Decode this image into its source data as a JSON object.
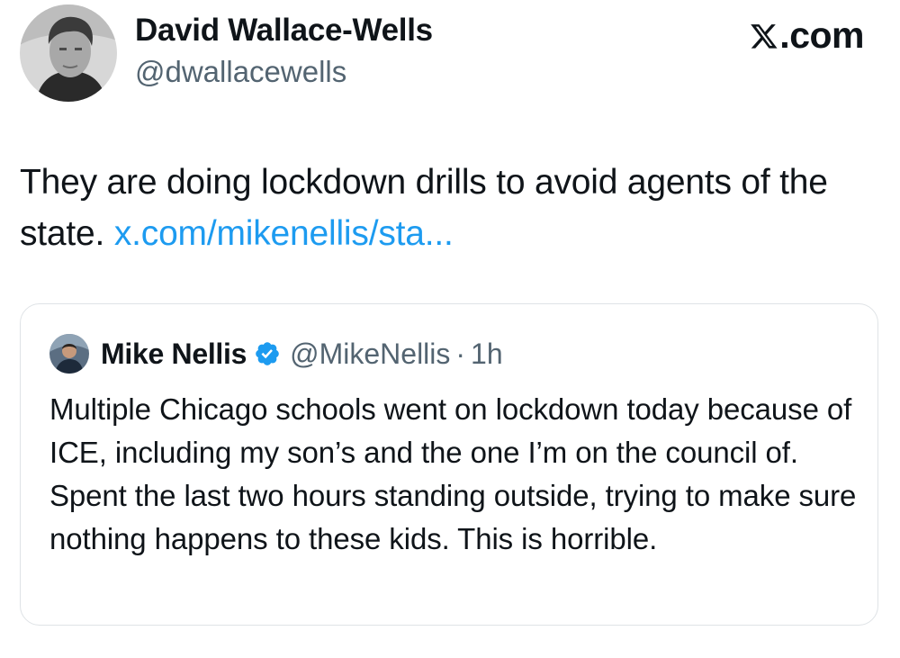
{
  "tweet": {
    "author_name": "David Wallace-Wells",
    "author_handle": "@dwallacewells",
    "brand_label": ".com",
    "brand_icon": "x-logo-icon",
    "text": "They are doing lockdown drills to avoid agents of the state. ",
    "link_text": "x.com/mikenellis/sta...",
    "link_color": "#1d9bf0"
  },
  "quote": {
    "author_name": "Mike Nellis",
    "verified_icon": "verified-badge-icon",
    "verified_color": "#1d9bf0",
    "author_handle": "@MikeNellis",
    "separator": "·",
    "timestamp": "1h",
    "text": "Multiple Chicago schools went on lockdown today because of ICE, including my son’s and the one I’m on the council of. Spent the last two hours standing outside, trying to make sure nothing happens to these kids. This is horrible."
  }
}
